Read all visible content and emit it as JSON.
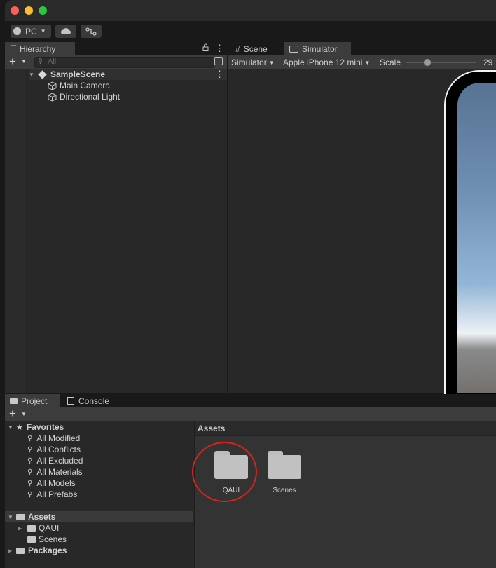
{
  "toolbar": {
    "platform": "PC"
  },
  "hierarchy": {
    "tab_label": "Hierarchy",
    "search_placeholder": "All",
    "scene_name": "SampleScene",
    "objects": [
      "Main Camera",
      "Directional Light"
    ]
  },
  "scene_view": {
    "tabs": [
      "Scene",
      "Simulator"
    ],
    "mode_label": "Simulator",
    "device_label": "Apple iPhone 12 mini",
    "scale_label": "Scale",
    "scale_value": "29"
  },
  "project": {
    "tabs": [
      "Project",
      "Console"
    ],
    "favorites_label": "Favorites",
    "favorites": [
      "All Modified",
      "All Conflicts",
      "All Excluded",
      "All Materials",
      "All Models",
      "All Prefabs"
    ],
    "assets_label": "Assets",
    "asset_folders": [
      "QAUI",
      "Scenes"
    ],
    "packages_label": "Packages",
    "breadcrumb": "Assets",
    "grid_items": [
      "QAUI",
      "Scenes"
    ]
  },
  "colors": {
    "highlight_circle": "#d8231f",
    "close": "#ff5f57",
    "minimize": "#febc2e",
    "zoom": "#28c840"
  }
}
